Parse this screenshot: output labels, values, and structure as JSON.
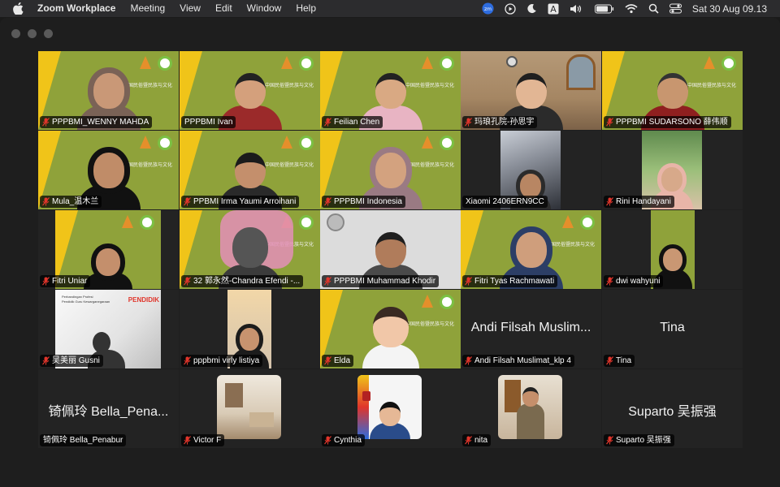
{
  "menubar": {
    "app_name": "Zoom Workplace",
    "menus": [
      "Meeting",
      "View",
      "Edit",
      "Window",
      "Help"
    ],
    "clock": "Sat 30 Aug  09.13",
    "status_icons": [
      "zoom-icon",
      "play-icon",
      "moon-icon",
      "keyboard-a-icon",
      "volume-icon",
      "battery-icon",
      "wifi-icon",
      "search-icon",
      "control-center-icon"
    ]
  },
  "gallery": {
    "tiles": [
      {
        "name": "PPPBMI_WENNY MAHDA",
        "muted": true
      },
      {
        "name": "PPPBMI Ivan",
        "muted": false,
        "active": true
      },
      {
        "name": "Feilian Chen",
        "muted": true
      },
      {
        "name": "玛琅孔院-孙思宇",
        "muted": true
      },
      {
        "name": "PPPBMI SUDARSONO 薛伟顺",
        "muted": true
      },
      {
        "name": "Mula_温木兰",
        "muted": true
      },
      {
        "name": "PPBMI Irma Yaumi Arroihani",
        "muted": true
      },
      {
        "name": "PPPBMI Indonesia",
        "muted": true
      },
      {
        "name": "Xiaomi 2406ERN9CC",
        "muted": false
      },
      {
        "name": "Rini Handayani",
        "muted": true
      },
      {
        "name": "Fitri Uniar",
        "muted": true
      },
      {
        "name": "32 郭永然-Chandra Efendi -...",
        "muted": true
      },
      {
        "name": "PPPBMI Muhammad Khodir",
        "muted": true
      },
      {
        "name": "Fitri Tyas Rachmawati",
        "muted": true
      },
      {
        "name": "dwi wahyuni",
        "muted": true
      },
      {
        "name": "吴美丽 Gusni",
        "muted": true
      },
      {
        "name": "pppbmi virly listiya",
        "muted": true
      },
      {
        "name": "Elda",
        "muted": true
      },
      {
        "name": "Andi Filsah Muslimat_klp 4",
        "muted": true,
        "display_name": "Andi Filsah Muslim..."
      },
      {
        "name": "Tina",
        "muted": true,
        "display_name": "Tina"
      },
      {
        "name": "锜佩玲 Bella_Penabur",
        "muted": false,
        "display_name": "锜佩玲 Bella_Pena..."
      },
      {
        "name": "Victor F",
        "muted": true
      },
      {
        "name": "Cynthia",
        "muted": true
      },
      {
        "name": "nita",
        "muted": true
      },
      {
        "name": "Suparto 吴振强",
        "muted": true,
        "display_name": "Suparto 吴振强"
      }
    ],
    "banner_text": "中国民俗暨民族与文化",
    "slide_text": {
      "line1": "Perbandingan Profesi",
      "line2": "Pendidik Guru Kewarganegaraan",
      "badge": "PENDIDIK"
    },
    "colors": {
      "active_border": "#4caf50",
      "muted_icon": "#e0352b",
      "banner_green": "#8fa23a",
      "banner_yellow": "#f0c419"
    }
  }
}
